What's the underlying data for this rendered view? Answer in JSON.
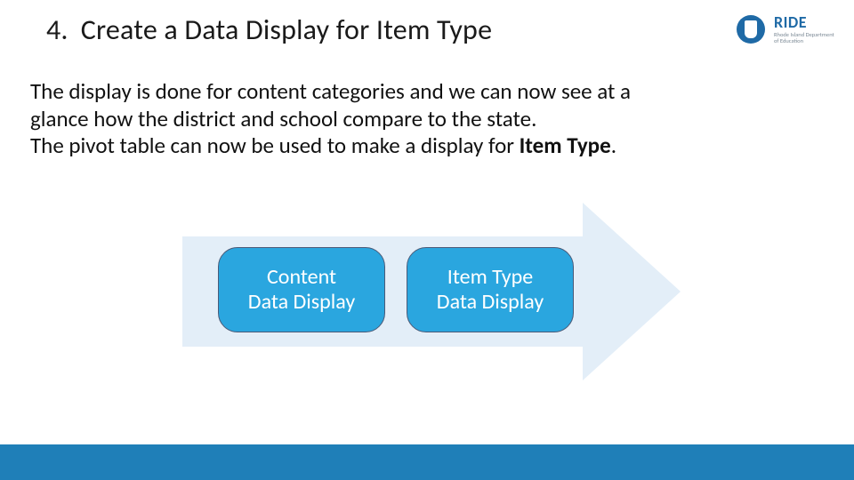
{
  "header": {
    "number": "4.",
    "title": "Create a Data Display for Item Type"
  },
  "logo": {
    "brand": "RIDE",
    "subtitle": "Rhode Island Department of Education"
  },
  "body": {
    "line1": "The display is done for content categories and we can now see at a",
    "line2": "glance how the district and school compare to the state.",
    "line3_prefix": "The pivot table can now be used to make a display for ",
    "line3_bold": "Item Type",
    "line3_suffix": "."
  },
  "diagram": {
    "pills": [
      {
        "line1": "Content",
        "line2": "Data Display"
      },
      {
        "line1": "Item Type",
        "line2": "Data Display"
      }
    ]
  },
  "colors": {
    "arrow_fill": "#e3eef8",
    "pill_fill": "#2aa6df",
    "footer": "#1f7fb8"
  }
}
